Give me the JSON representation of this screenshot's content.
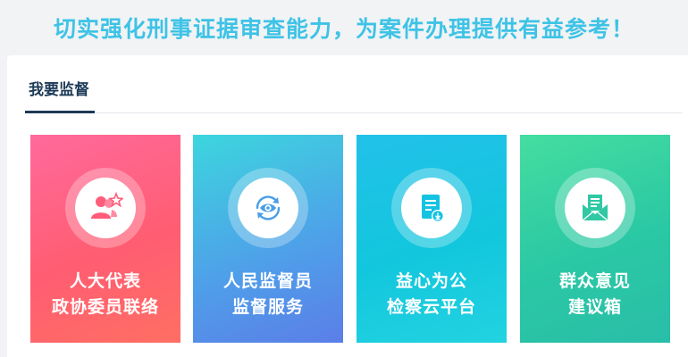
{
  "banner": {
    "text": "切实强化刑事证据审查能力，为案件办理提供有益参考！"
  },
  "section": {
    "title": "我要监督"
  },
  "cards": [
    {
      "line1": "人大代表",
      "line2": "政协委员联络",
      "icon": "people-star-icon",
      "color": "#ff5d7a"
    },
    {
      "line1": "人民监督员",
      "line2": "监督服务",
      "icon": "eye-refresh-icon",
      "color": "#4a9ee8"
    },
    {
      "line1": "益心为公",
      "line2": "检察云平台",
      "icon": "document-download-icon",
      "color": "#14c3e2"
    },
    {
      "line1": "群众意见",
      "line2": "建议箱",
      "icon": "mailbox-icon",
      "color": "#30c9a4"
    }
  ]
}
